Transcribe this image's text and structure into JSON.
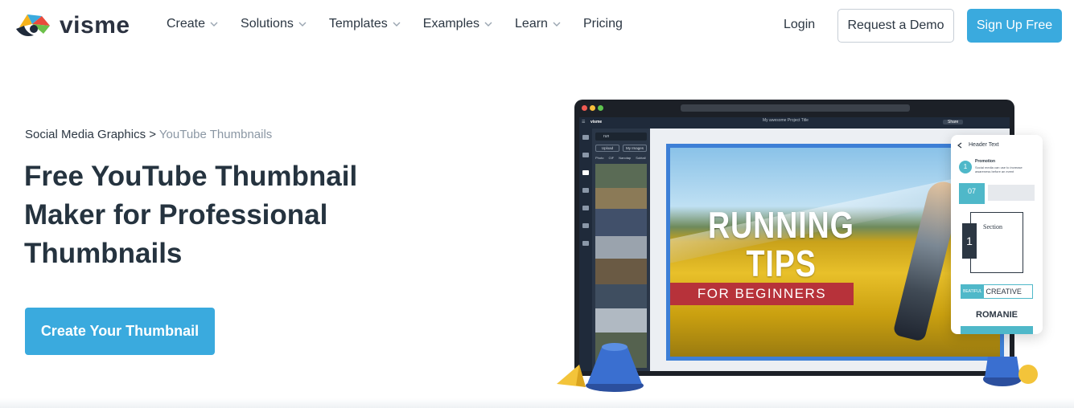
{
  "brand": {
    "name": "visme",
    "accent": "#3aaade",
    "text_dark": "#25333f"
  },
  "nav": {
    "items": [
      {
        "label": "Create",
        "has_dropdown": true
      },
      {
        "label": "Solutions",
        "has_dropdown": true
      },
      {
        "label": "Templates",
        "has_dropdown": true
      },
      {
        "label": "Examples",
        "has_dropdown": true
      },
      {
        "label": "Learn",
        "has_dropdown": true
      },
      {
        "label": "Pricing",
        "has_dropdown": false
      }
    ],
    "login": "Login",
    "demo": "Request a Demo",
    "signup": "Sign Up Free"
  },
  "hero": {
    "breadcrumb_parent": "Social Media Graphics",
    "breadcrumb_sep": ">",
    "breadcrumb_current": "YouTube Thumbnails",
    "title": "Free YouTube Thumbnail Maker for Professional Thumbnails",
    "cta": "Create Your Thumbnail"
  },
  "mockup": {
    "app_logo": "visme",
    "project_title": "My awesome Project Title",
    "search_value": "run",
    "upload": "Upload",
    "my_images": "My Images",
    "tabs": [
      "Photo",
      "GIF",
      "Nanotap",
      "Subtail"
    ],
    "share": "Share",
    "thumbnail_line1": "RUNNING",
    "thumbnail_line2": "TIPS",
    "thumbnail_ribbon": "FOR BEGINNERS",
    "panel_header": "Header Text",
    "panel_promotion": "Promotion",
    "panel_promotion_text": "Social media can use to increase awareness before an event",
    "panel_number": "1",
    "panel_date_day": "07",
    "panel_section": "Section",
    "panel_section_num": "1",
    "panel_beatiful": "BEATIFUL",
    "panel_creative": "CREATIVE",
    "panel_romanie": "ROMANIE"
  }
}
